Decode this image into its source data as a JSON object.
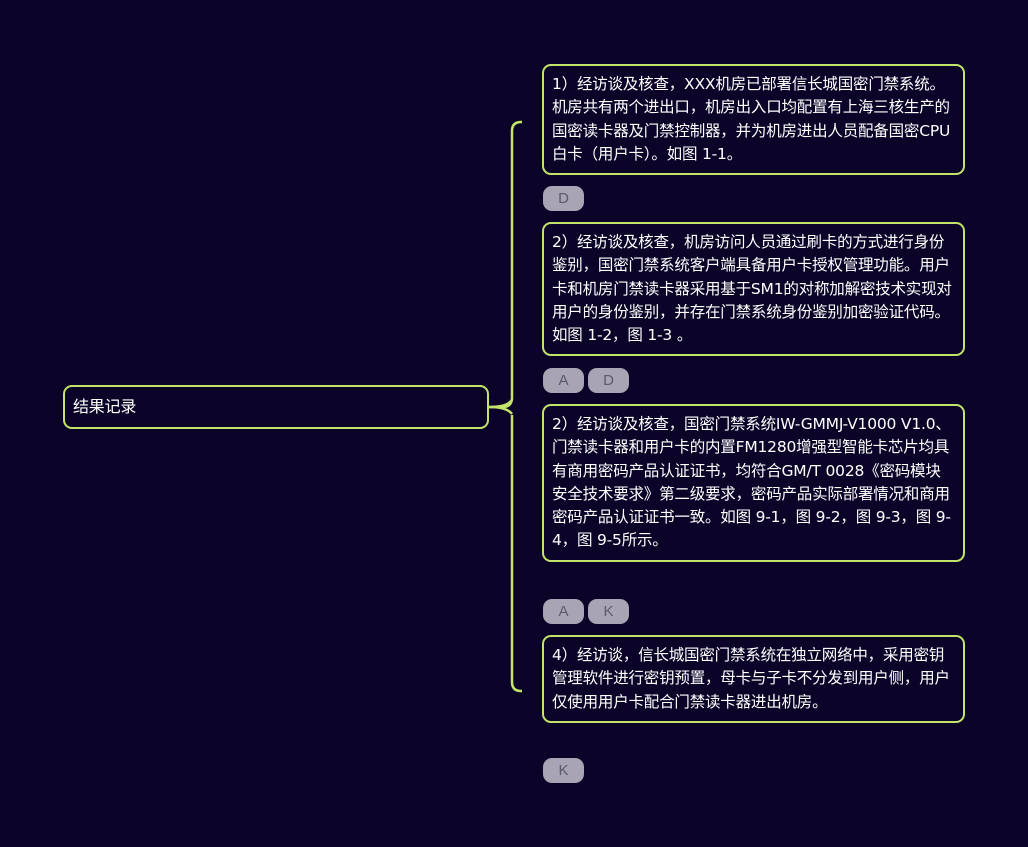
{
  "root": {
    "label": "结果记录"
  },
  "children": [
    {
      "text": "1）经访谈及核查，XXX机房已部署信长城国密门禁系统。机房共有两个进出口，机房出入口均配置有上海三核生产的国密读卡器及门禁控制器，并为机房进出人员配备国密CPU白卡（用户卡）。如图 1-1。",
      "tags": [
        "D"
      ]
    },
    {
      "text": "2）经访谈及核查，机房访问人员通过刷卡的方式进行身份鉴别，国密门禁系统客户端具备用户卡授权管理功能。用户卡和机房门禁读卡器采用基于SM1的对称加解密技术实现对用户的身份鉴别，并存在门禁系统身份鉴别加密验证代码。如图 1-2，图 1-3 。",
      "tags": [
        "A",
        "D"
      ]
    },
    {
      "text": "2）经访谈及核查，国密门禁系统IW-GMMJ-V1000 V1.0、门禁读卡器和用户卡的内置FM1280增强型智能卡芯片均具有商用密码产品认证证书，均符合GM/T 0028《密码模块安全技术要求》第二级要求，密码产品实际部署情况和商用密码产品认证证书一致。如图 9-1，图 9-2，图 9-3，图 9-4，图 9-5所示。",
      "tags": [
        "A",
        "K"
      ]
    },
    {
      "text": "4）经访谈，信长城国密门禁系统在独立网络中，采用密钥管理软件进行密钥预置，母卡与子卡不分发到用户侧，用户仅使用用户卡配合门禁读卡器进出机房。",
      "tags": [
        "K"
      ]
    }
  ],
  "colors": {
    "background": "#0b0428",
    "border": "#c3e36a",
    "text": "#ffffff",
    "tag_background": "#a8a4b4",
    "tag_text": "#5d5a6d"
  }
}
